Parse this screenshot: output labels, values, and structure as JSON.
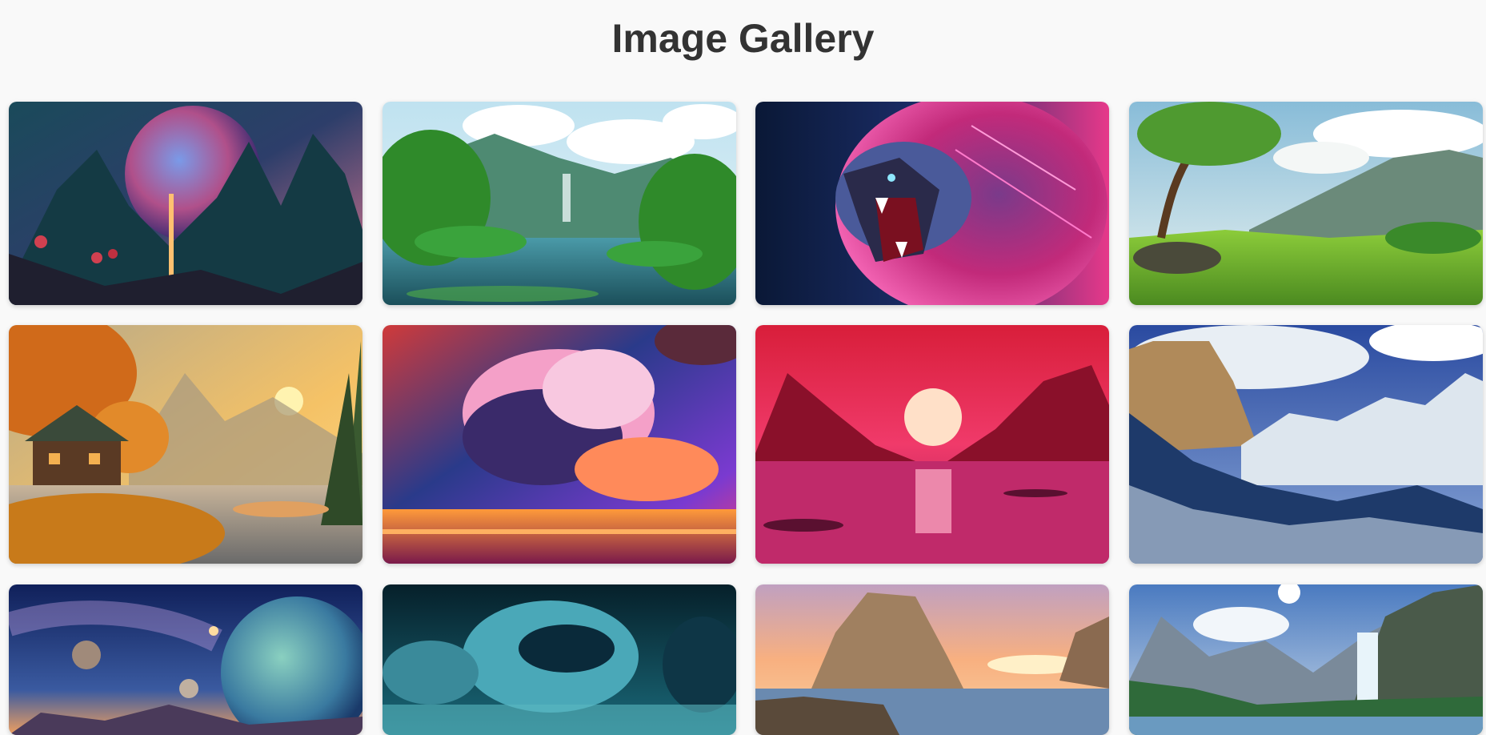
{
  "page": {
    "title": "Image Gallery"
  },
  "gallery": {
    "images": [
      {
        "subject": "alien-planet-landscape-image"
      },
      {
        "subject": "tropical-lake-valley-image"
      },
      {
        "subject": "neon-roaring-lion-image"
      },
      {
        "subject": "green-meadow-mountains-image"
      },
      {
        "subject": "autumn-cabin-lake-image"
      },
      {
        "subject": "colorful-clouds-sunset-image"
      },
      {
        "subject": "crimson-sunset-sea-image"
      },
      {
        "subject": "snowy-granite-valley-image"
      },
      {
        "subject": "space-planets-galaxy-image"
      },
      {
        "subject": "teal-night-clouds-image"
      },
      {
        "subject": "sea-rock-sunset-image"
      },
      {
        "subject": "mountain-waterfall-river-image"
      }
    ]
  },
  "colors": {
    "background": "#f9f9f9",
    "title": "#333333"
  }
}
